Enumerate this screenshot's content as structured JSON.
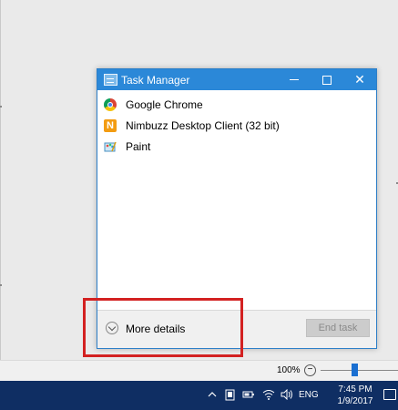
{
  "task_manager": {
    "title": "Task Manager",
    "processes": [
      {
        "label": "Google Chrome",
        "icon": "chrome-icon"
      },
      {
        "label": "Nimbuzz Desktop Client (32 bit)",
        "icon": "nimbuzz-icon",
        "icon_glyph": "N"
      },
      {
        "label": "Paint",
        "icon": "paint-icon"
      }
    ],
    "more_details_label": "More details",
    "end_task_label": "End task",
    "controls": {
      "minimize": "minimize",
      "maximize": "maximize",
      "close": "✕"
    }
  },
  "background_app": {
    "zoom_level": "100%"
  },
  "taskbar": {
    "language": "ENG",
    "time": "7:45 PM",
    "date": "1/9/2017"
  },
  "colors": {
    "titlebar": "#2b88d8",
    "taskbar": "#0f2e63",
    "highlight": "#d32121"
  }
}
